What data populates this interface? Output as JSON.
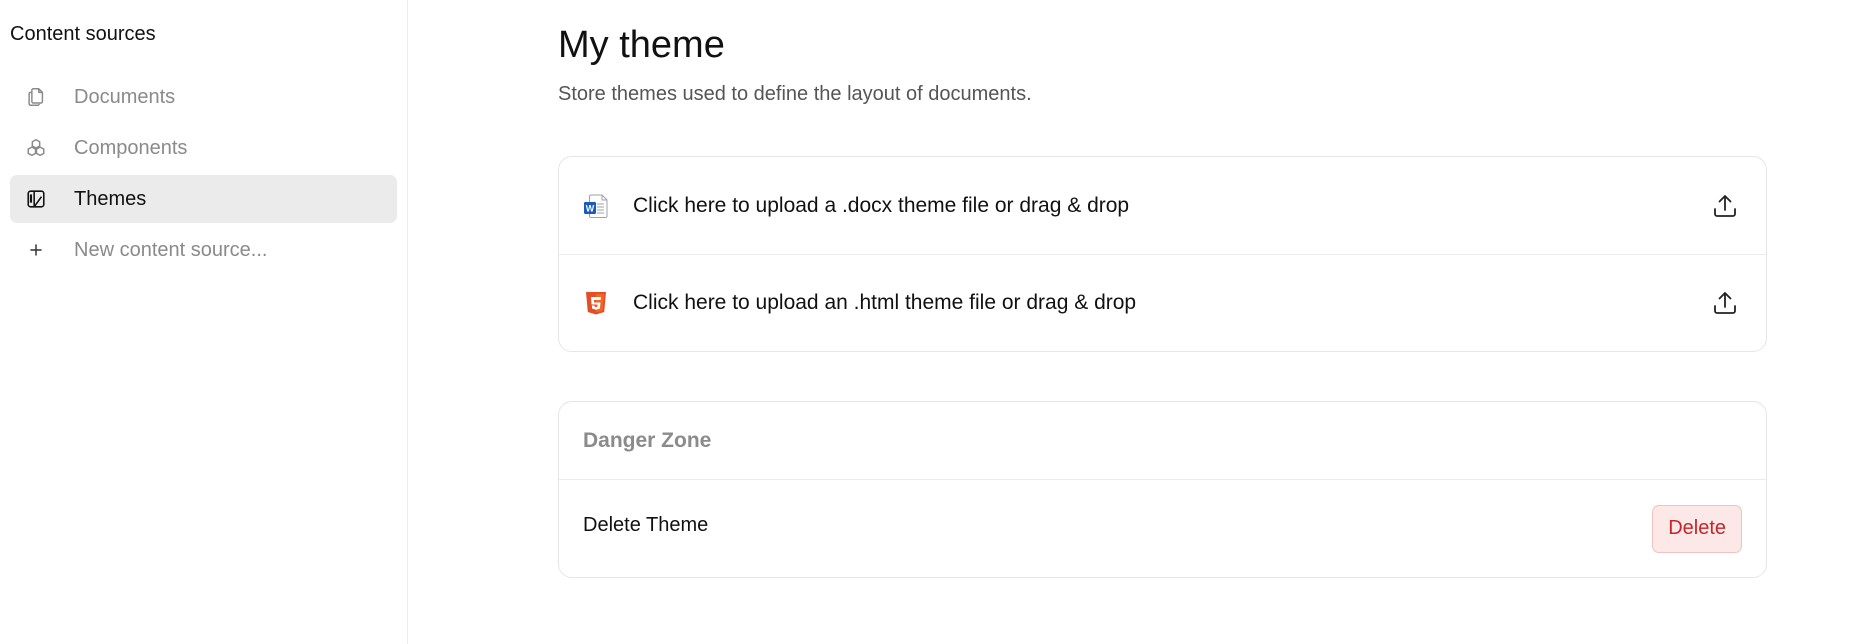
{
  "sidebar": {
    "title": "Content sources",
    "items": [
      {
        "label": "Documents",
        "icon": "documents-icon"
      },
      {
        "label": "Components",
        "icon": "components-icon"
      },
      {
        "label": "Themes",
        "icon": "themes-icon",
        "active": true
      },
      {
        "label": "New content source...",
        "icon": "plus-icon"
      }
    ]
  },
  "main": {
    "title": "My theme",
    "subtitle": "Store themes used to define the layout of documents.",
    "uploads": [
      {
        "label": "Click here to upload a .docx theme file or drag & drop",
        "icon": "word-file-icon"
      },
      {
        "label": "Click here to upload an .html theme file or drag & drop",
        "icon": "html5-icon"
      }
    ],
    "danger_zone": {
      "title": "Danger Zone",
      "row_label": "Delete Theme",
      "button_label": "Delete"
    }
  },
  "colors": {
    "active_nav_bg": "#ebebeb",
    "delete_bg": "#fde8e8",
    "delete_text": "#c1272d",
    "word_blue": "#185abd",
    "html_orange": "#e44d26"
  }
}
